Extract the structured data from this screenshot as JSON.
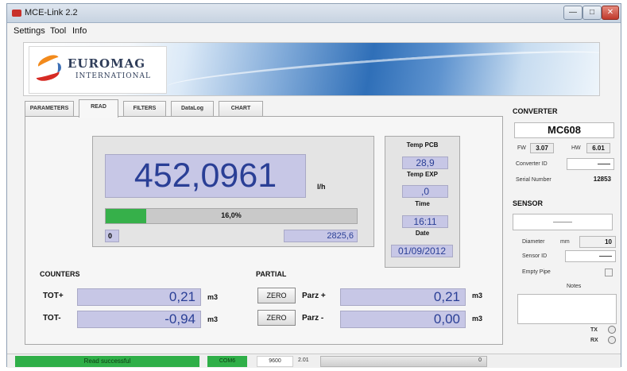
{
  "window": {
    "title": "MCE-Link 2.2"
  },
  "menu": [
    "Settings",
    "Tool",
    "Info"
  ],
  "logo": {
    "name": "EUROMAG",
    "subtitle": "INTERNATIONAL"
  },
  "tabs": [
    {
      "label": "PARAMETERS",
      "active": false
    },
    {
      "label": "READ",
      "active": true
    },
    {
      "label": "FILTERS",
      "active": false
    },
    {
      "label": "DataLog",
      "active": false
    },
    {
      "label": "CHART",
      "active": false
    }
  ],
  "reading": {
    "flow_value": "452,0961",
    "flow_unit": "l/h",
    "progress_fraction": 0.16,
    "progress_label": "16,0%",
    "range_min": "0",
    "range_max": "2825,6"
  },
  "side": {
    "temp_pcb_label": "Temp PCB",
    "temp_pcb_value": "28,9",
    "temp_exp_label": "Temp EXP",
    "temp_exp_value": ",0",
    "time_label": "Time",
    "time_value": "16:11",
    "date_label": "Date",
    "date_value": "01/09/2012"
  },
  "counters": {
    "title": "COUNTERS",
    "tot_plus_label": "TOT+",
    "tot_plus_value": "0,21",
    "tot_minus_label": "TOT-",
    "tot_minus_value": "-0,94",
    "unit": "m3"
  },
  "partial": {
    "title": "PARTIAL",
    "zero_label": "ZERO",
    "parz_plus_label": "Parz +",
    "parz_plus_value": "0,21",
    "parz_minus_label": "Parz -",
    "parz_minus_value": "0,00",
    "unit": "m3"
  },
  "converter": {
    "title": "CONVERTER",
    "model": "MC608",
    "fw_label": "FW",
    "fw_value": "3.07",
    "hw_label": "HW",
    "hw_value": "6.01",
    "id_label": "Converter ID",
    "id_value": "——",
    "serial_label": "Serial Number",
    "serial_value": "12853"
  },
  "sensor": {
    "title": "SENSOR",
    "name": "———",
    "diameter_label": "Diameter",
    "diameter_unit": "mm",
    "diameter_value": "10",
    "id_label": "Sensor ID",
    "id_value": "——",
    "empty_pipe_label": "Empty Pipe",
    "notes_label": "Notes",
    "tx_label": "TX",
    "rx_label": "RX"
  },
  "status": {
    "message": "Read successful",
    "port": "COM6",
    "baud": "9600",
    "version": "2.01",
    "counter": "0"
  },
  "colors": {
    "value_bg": "#c7c7e6",
    "value_text": "#2a3f96",
    "progress_fill": "#36b04a",
    "status_green": "#2faf48"
  }
}
